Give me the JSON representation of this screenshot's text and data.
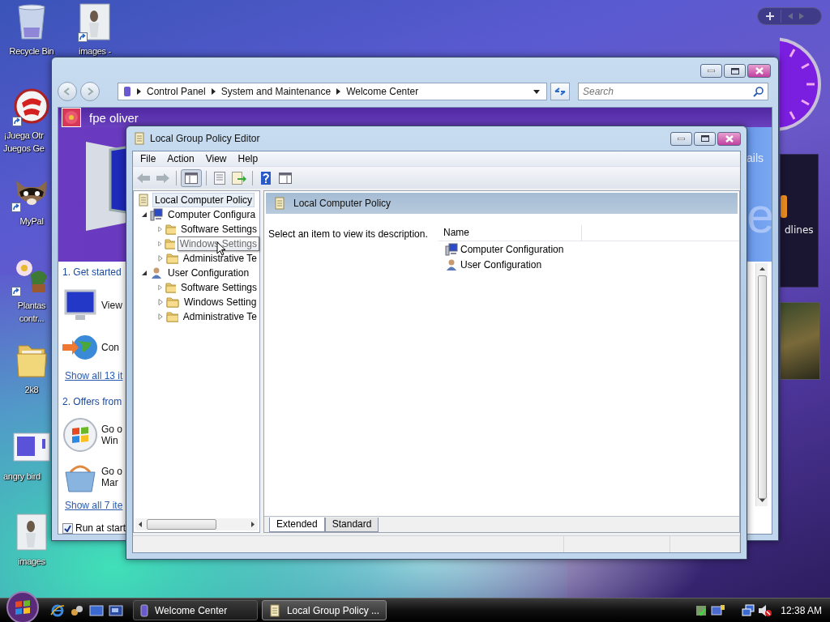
{
  "desktop": {
    "icons": [
      {
        "kind": "bin",
        "lines": [
          "Recycle Bin"
        ],
        "shortcut": false
      },
      {
        "kind": "photo",
        "lines": [
          "images -"
        ],
        "shortcut": true
      },
      {
        "kind": "popcap",
        "lines": [
          "¡Juega Otr",
          "Juegos Ge"
        ],
        "shortcut": true
      },
      {
        "kind": "raccoon",
        "lines": [
          "MyPal"
        ],
        "shortcut": true
      },
      {
        "kind": "flower",
        "lines": [
          "Plantas",
          "contr..."
        ],
        "shortcut": true
      },
      {
        "kind": "folder",
        "lines": [
          "2k8"
        ],
        "shortcut": false
      },
      {
        "kind": "screenshot",
        "lines": [
          "angry bird"
        ],
        "shortcut": false
      },
      {
        "kind": "photo",
        "lines": [
          "images"
        ],
        "shortcut": false
      }
    ]
  },
  "gadgets": {
    "news_fragment": "dlines"
  },
  "welcome_window": {
    "breadcrumb": [
      "Control Panel",
      "System and Maintenance",
      "Welcome Center"
    ],
    "search": {
      "placeholder": "Search"
    },
    "user_name": "fpe oliver",
    "banner_fragment": "ails",
    "banner_letter": "e",
    "sections": [
      {
        "heading": "1. Get started",
        "items": [
          {
            "kind": "monitor",
            "lines": [
              "View"
            ]
          },
          {
            "kind": "globe",
            "lines": [
              "Con"
            ]
          }
        ],
        "link": "Show all 13 it"
      },
      {
        "heading": "2. Offers from",
        "items": [
          {
            "kind": "windows",
            "lines": [
              "Go o",
              "Win"
            ]
          },
          {
            "kind": "basket",
            "lines": [
              "Go o",
              "Mar"
            ]
          }
        ],
        "link": "Show all 7 ite"
      }
    ],
    "run_at_startup": {
      "label": "Run at start",
      "checked": true
    }
  },
  "gpedit": {
    "title": "Local Group Policy Editor",
    "menu": [
      "File",
      "Action",
      "View",
      "Help"
    ],
    "tree": [
      {
        "label": "Local Computer Policy",
        "kind": "policy",
        "selected": true,
        "hovered": false,
        "children": [
          {
            "label": "Computer Configura",
            "kind": "computer",
            "selected": false,
            "hovered": false,
            "expanded": true,
            "children": [
              {
                "label": "Software Settings",
                "kind": "folder",
                "selected": false,
                "hovered": false,
                "expanded": false
              },
              {
                "label": "Windows Settings",
                "kind": "folder",
                "selected": false,
                "hovered": true,
                "expanded": false
              },
              {
                "label": "Administrative Te",
                "kind": "folder",
                "selected": false,
                "hovered": false,
                "expanded": false
              }
            ]
          },
          {
            "label": "User Configuration",
            "kind": "user",
            "selected": false,
            "hovered": false,
            "expanded": true,
            "children": [
              {
                "label": "Software Settings",
                "kind": "folder",
                "selected": false,
                "hovered": false,
                "expanded": false
              },
              {
                "label": "Windows Setting",
                "kind": "folder",
                "selected": false,
                "hovered": false,
                "expanded": false
              },
              {
                "label": "Administrative Te",
                "kind": "folder",
                "selected": false,
                "hovered": false,
                "expanded": false
              }
            ]
          }
        ]
      }
    ],
    "header": "Local Computer Policy",
    "description": "Select an item to view its description.",
    "columns": [
      "Name"
    ],
    "rows": [
      {
        "kind": "computer",
        "name": "Computer Configuration"
      },
      {
        "kind": "user",
        "name": "User Configuration"
      }
    ],
    "tabs": [
      {
        "label": "Extended",
        "selected": true
      },
      {
        "label": "Standard",
        "selected": false
      }
    ]
  },
  "taskbar": {
    "tasks": [
      {
        "kind": "control-panel",
        "label": "Welcome Center",
        "selected": false
      },
      {
        "kind": "policy",
        "label": "Local Group Policy ...",
        "selected": true
      }
    ],
    "clock": "12:38 AM"
  }
}
